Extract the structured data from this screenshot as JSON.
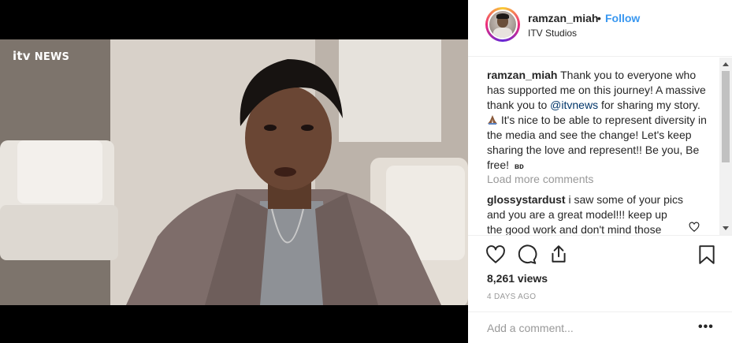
{
  "video": {
    "channel_logo": {
      "brand": "itv",
      "text": "NEWS"
    }
  },
  "post": {
    "username": "ramzan_miah",
    "separator": "•",
    "follow_label": "Follow",
    "location": "ITV Studios",
    "caption": {
      "username": "ramzan_miah",
      "text_part1": "Thank you to everyone who has supported me on this journey! A massive thank you to",
      "mention": "@itvnews",
      "text_part2": "for sharing my story.",
      "emoji_icon": "folded-hands-icon",
      "text_part3": "It's nice to be able to represent diversity in the media and see the change! Let's keep sharing the love and represent!! Be you, Be free!",
      "suffix": "ʙᴅ"
    },
    "load_more_label": "Load more comments",
    "comments": [
      {
        "username": "glossystardust",
        "text": "i saw some of your pics and you are a great model!!! keep up the good work and don't mind those"
      }
    ],
    "views": "8,261 views",
    "posted_ago": "4 DAYS AGO",
    "add_comment_placeholder": "Add a comment...",
    "more_label": "•••"
  },
  "colors": {
    "follow": "#3897f0",
    "mention": "#003569",
    "muted": "#999999",
    "text": "#262626"
  },
  "icons": [
    "heart-icon",
    "comment-icon",
    "share-icon",
    "bookmark-icon",
    "more-options-icon"
  ]
}
